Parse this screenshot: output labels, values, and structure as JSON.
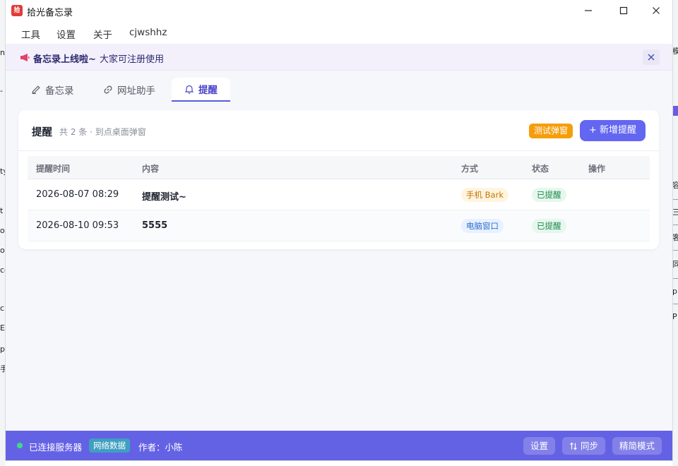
{
  "window": {
    "title": "拾光备忘录",
    "icon_text": "拾"
  },
  "menu": [
    "工具",
    "设置",
    "关于",
    "cjwshhz"
  ],
  "announcement": {
    "title": "备忘录上线啦~",
    "text": "大家可注册使用"
  },
  "tabs": [
    {
      "label": "备忘录",
      "icon": "pencil-icon",
      "active": false
    },
    {
      "label": "网址助手",
      "icon": "link-icon",
      "active": false
    },
    {
      "label": "提醒",
      "icon": "bell-icon",
      "active": true
    }
  ],
  "reminders": {
    "title": "提醒",
    "subtitle": "共 2 条 · 到点桌面弹窗",
    "test_button": "测试弹窗",
    "add_button": "+ 新增提醒",
    "columns": [
      "提醒时间",
      "内容",
      "方式",
      "状态",
      "操作"
    ],
    "rows": [
      {
        "time": "2026-08-07 08:29",
        "content": "提醒测试~",
        "method": "手机 Bark",
        "status": "已提醒"
      },
      {
        "time": "2026-08-10 09:53",
        "content": "5555",
        "method": "电脑窗口",
        "status": "已提醒"
      }
    ]
  },
  "footer": {
    "status": "已连接服务器",
    "network": "网络数据",
    "author": "作者：小陈",
    "settings": "设置",
    "sync": "同步",
    "simple_mode": "精简模式"
  },
  "colors": {
    "accent": "#6366f1",
    "footer": "#6462e4",
    "warning": "#f59e0b",
    "success": "#1a8a4a"
  }
}
